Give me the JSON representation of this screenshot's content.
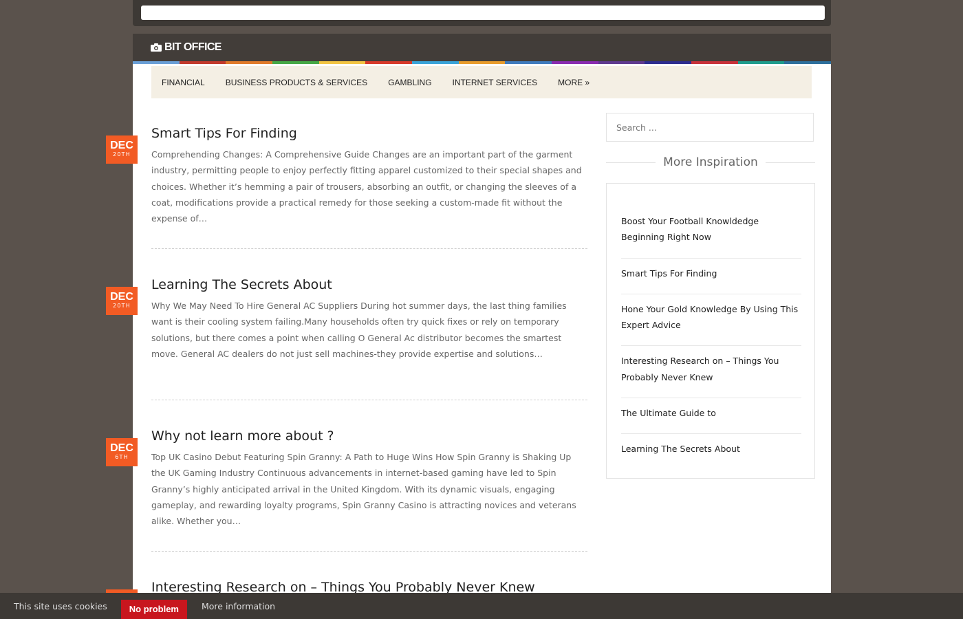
{
  "header": {
    "site_title": "BIT OFFICE",
    "logo_icon": "camera-icon"
  },
  "colors": {
    "background": "#5a524c",
    "header": "#423d39",
    "accent": "#f25b24",
    "nav_bg": "#f4efe4",
    "cookie_button": "#c8161e",
    "color_strip": [
      "#6a9fd6",
      "#c23a2c",
      "#e07a2a",
      "#45a846",
      "#f2c443",
      "#d73a2a",
      "#3aa3d8",
      "#e89c2c",
      "#3f7bbd",
      "#8a2bb0",
      "#5f3a8f",
      "#2d2d8f",
      "#c8323a",
      "#1e9c8c",
      "#2d6f9c"
    ]
  },
  "nav": {
    "items": [
      {
        "label": "FINANCIAL"
      },
      {
        "label": "BUSINESS PRODUCTS & SERVICES"
      },
      {
        "label": "GAMBLING"
      },
      {
        "label": "INTERNET SERVICES"
      },
      {
        "label": "MORE »"
      }
    ]
  },
  "posts": [
    {
      "title": "Smart Tips For Finding",
      "month": "DEC",
      "day": "20TH",
      "excerpt": "Comprehending Changes: A Comprehensive Guide Changes are an important part of the garment industry, permitting people to enjoy perfectly fitting apparel customized to their special shapes and choices. Whether it’s hemming a pair of trousers, absorbing an outfit, or changing the sleeves of a coat, modifications provide a practical remedy for those seeking a custom-made fit without the expense of…"
    },
    {
      "title": "Learning The Secrets About",
      "month": "DEC",
      "day": "20TH",
      "excerpt": "Why We May Need To Hire General AC Suppliers During hot summer days, the last thing families want is their cooling system failing.Many households often try quick fixes or rely on temporary solutions, but there comes a point when calling O General Ac distributor becomes the smartest move. General AC dealers do not just sell machines-they provide expertise and solutions…"
    },
    {
      "title": "Why not learn more about ?",
      "month": "DEC",
      "day": "6TH",
      "excerpt": "Top UK Casino Debut Featuring Spin Granny: A Path to Huge Wins How Spin Granny is Shaking Up the UK Gaming Industry Continuous advancements in internet-based gaming have led to Spin Granny’s highly anticipated arrival in the United Kingdom. With its dynamic visuals, engaging gameplay, and rewarding loyalty programs, Spin Granny Casino is attracting novices and veterans alike. Whether you…"
    },
    {
      "title": "Interesting Research on – Things You Probably Never Knew",
      "month": "",
      "day": "",
      "excerpt": ""
    }
  ],
  "sidebar": {
    "search_placeholder": "Search ...",
    "widget_title": "More Inspiration",
    "items": [
      {
        "label": "Boost Your Football Knowldedge Beginning Right Now"
      },
      {
        "label": "Smart Tips For Finding"
      },
      {
        "label": "Hone Your Gold Knowledge By Using This Expert Advice"
      },
      {
        "label": "Interesting Research on – Things You Probably Never Knew"
      },
      {
        "label": "The Ultimate Guide to"
      },
      {
        "label": "Learning The Secrets About"
      }
    ]
  },
  "cookie": {
    "text": "This site uses cookies",
    "button": "No problem",
    "more": "More information"
  }
}
